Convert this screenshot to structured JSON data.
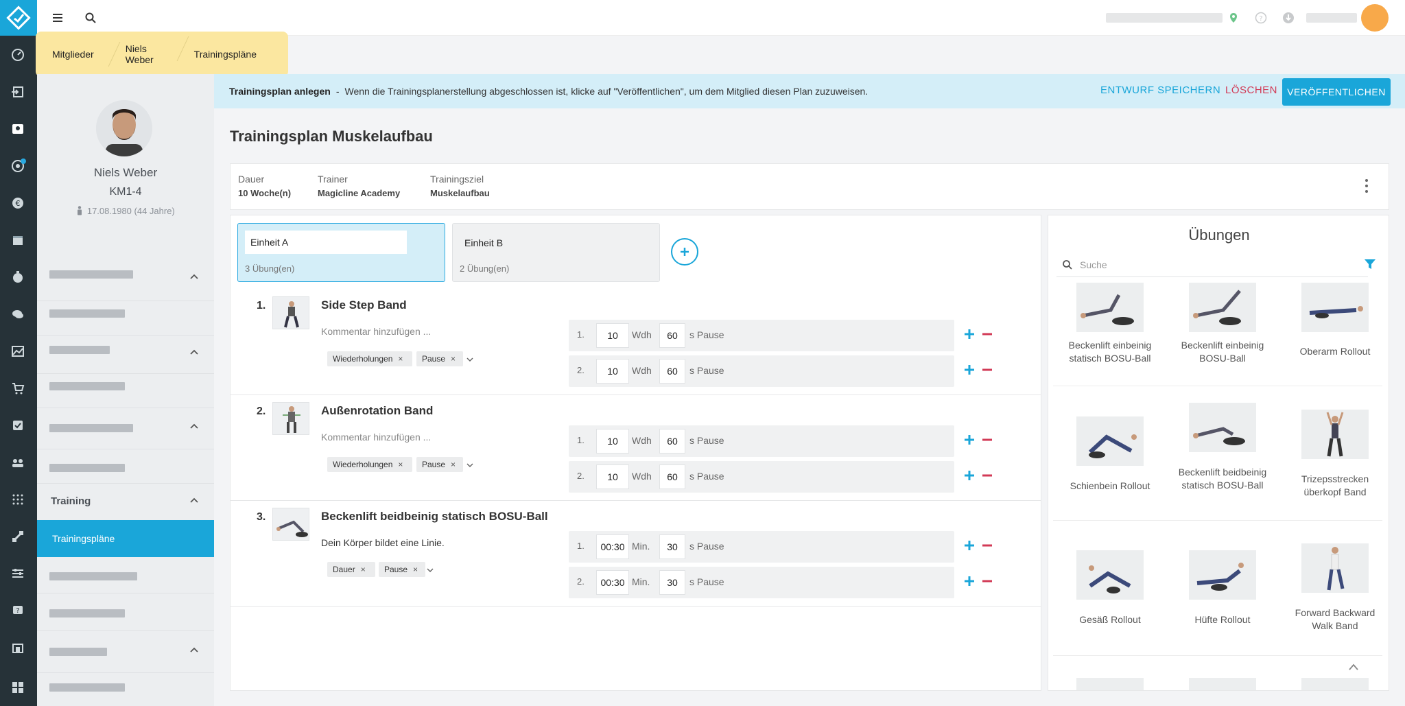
{
  "breadcrumb": [
    "Mitglieder",
    "Niels Weber",
    "Trainingspläne"
  ],
  "profile": {
    "name": "Niels Weber",
    "id": "KM1-4",
    "dob": "17.08.1980 (44 Jahre)"
  },
  "sidebar": {
    "section": "Training",
    "active": "Trainingspläne"
  },
  "banner": {
    "title": "Trainingsplan anlegen",
    "sep": "-",
    "text": "Wenn die Trainingsplanerstellung abgeschlossen ist, klicke auf \"Veröffentlichen\", um dem Mitglied diesen Plan zuzuweisen.",
    "draft": "ENTWURF SPEICHERN",
    "delete": "LÖSCHEN",
    "publish": "VERÖFFENTLICHEN"
  },
  "plan": {
    "title": "Trainingsplan Muskelaufbau",
    "meta": [
      {
        "label": "Dauer",
        "value": "10 Woche(n)"
      },
      {
        "label": "Trainer",
        "value": "Magicline Academy"
      },
      {
        "label": "Trainingsziel",
        "value": "Muskelaufbau"
      }
    ]
  },
  "units": [
    {
      "name": "Einheit A",
      "count": "3 Übung(en)"
    },
    {
      "name": "Einheit B",
      "count": "2 Übung(en)"
    }
  ],
  "exercises": [
    {
      "num": "1.",
      "name": "Side Step Band",
      "comment": "Kommentar hinzufügen ...",
      "tags": [
        "Wiederholungen",
        "Pause"
      ],
      "sets": [
        {
          "n": "1.",
          "v1": "10",
          "u1": "Wdh",
          "v2": "60",
          "u2": "s Pause"
        },
        {
          "n": "2.",
          "v1": "10",
          "u1": "Wdh",
          "v2": "60",
          "u2": "s Pause"
        }
      ]
    },
    {
      "num": "2.",
      "name": "Außenrotation Band",
      "comment": "Kommentar hinzufügen ...",
      "tags": [
        "Wiederholungen",
        "Pause"
      ],
      "sets": [
        {
          "n": "1.",
          "v1": "10",
          "u1": "Wdh",
          "v2": "60",
          "u2": "s Pause"
        },
        {
          "n": "2.",
          "v1": "10",
          "u1": "Wdh",
          "v2": "60",
          "u2": "s Pause"
        }
      ]
    },
    {
      "num": "3.",
      "name": "Beckenlift beidbeinig statisch BOSU-Ball",
      "comment": "Dein Körper bildet eine Linie.",
      "tags": [
        "Dauer",
        "Pause"
      ],
      "sets": [
        {
          "n": "1.",
          "v1": "00:30",
          "u1": "Min.",
          "v2": "30",
          "u2": "s Pause"
        },
        {
          "n": "2.",
          "v1": "00:30",
          "u1": "Min.",
          "v2": "30",
          "u2": "s Pause"
        }
      ]
    }
  ],
  "library": {
    "title": "Übungen",
    "search_placeholder": "Suche",
    "items": [
      {
        "label": "Beckenlift einbeinig statisch BOSU-Ball"
      },
      {
        "label": "Beckenlift einbeinig BOSU-Ball"
      },
      {
        "label": "Oberarm Rollout"
      },
      {
        "label": "Schienbein Rollout"
      },
      {
        "label": "Beckenlift beidbeinig statisch BOSU-Ball"
      },
      {
        "label": "Trizepsstrecken überkopf Band"
      },
      {
        "label": "Gesäß Rollout"
      },
      {
        "label": "Hüfte Rollout"
      },
      {
        "label": "Forward Backward Walk Band"
      }
    ]
  },
  "colors": {
    "accent": "#1aa6d9",
    "danger": "#d23a56",
    "highlight": "#fbe7a0",
    "avatar": "#f8a94a"
  },
  "icons": {
    "menu": "menu-icon",
    "search": "search-icon",
    "plus": "plus-icon",
    "minus": "minus-icon",
    "filter": "filter-icon",
    "more": "kebab-icon"
  }
}
